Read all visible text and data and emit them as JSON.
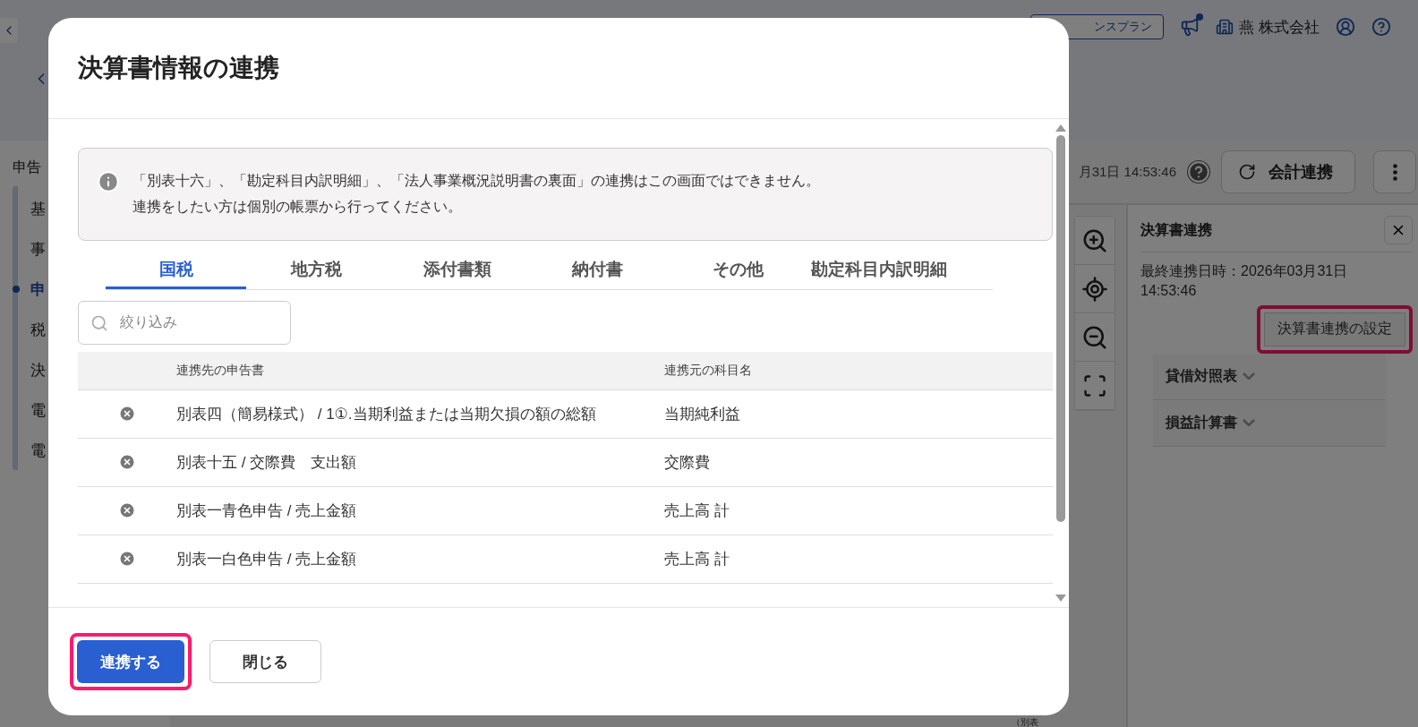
{
  "app_header": {
    "plan_button": "ンスプラン",
    "company": "燕 株式会社",
    "has_notification": true
  },
  "sidebar": {
    "title": "申告",
    "items": [
      {
        "label": "基",
        "selected": false
      },
      {
        "label": "事",
        "selected": false
      },
      {
        "label": "申",
        "selected": true
      },
      {
        "label": "税",
        "selected": false
      },
      {
        "label": "決",
        "selected": false
      },
      {
        "label": "電",
        "selected": false
      },
      {
        "label": "電",
        "selected": false
      }
    ]
  },
  "toolbar": {
    "timestamp": "月31日 14:53:46",
    "sync_button": "会計連携"
  },
  "side_panel": {
    "title": "決算書連携",
    "last_sync": "最終連携日時：2026年03月31日 14:53:46",
    "settings_button": {
      "label": "決算書連携の設定",
      "highlighted": true
    },
    "sections": [
      {
        "label": "貸借対照表",
        "expanded": false
      },
      {
        "label": "損益計算書",
        "expanded": false
      }
    ]
  },
  "document_preview": {
    "text": "（別表"
  },
  "modal": {
    "title": "決算書情報の連携",
    "notice": [
      "「別表十六」、「勘定科目内訳明細」、「法人事業概況説明書の裏面」の連携はこの画面ではできません。",
      "連携をしたい方は個別の帳票から行ってください。"
    ],
    "tabs": [
      {
        "label": "国税",
        "selected": true
      },
      {
        "label": "地方税",
        "selected": false
      },
      {
        "label": "添付書類",
        "selected": false
      },
      {
        "label": "納付書",
        "selected": false
      },
      {
        "label": "その他",
        "selected": false
      },
      {
        "label": "勘定科目内訳明細",
        "selected": false
      }
    ],
    "filter": {
      "placeholder": "絞り込み"
    },
    "table": {
      "columns": [
        "連携先の申告書",
        "連携元の科目名"
      ],
      "rows": [
        {
          "target": "別表四（簡易様式） / 1①.当期利益または当期欠損の額の総額",
          "source": "当期純利益"
        },
        {
          "target": "別表十五 / 交際費　支出額",
          "source": "交際費"
        },
        {
          "target": "別表一青色申告 / 売上金額",
          "source": "売上高 計"
        },
        {
          "target": "別表一白色申告 / 売上金額",
          "source": "売上高 計"
        }
      ]
    },
    "buttons": [
      {
        "label": "連携する",
        "kind": "primary",
        "highlighted": true
      },
      {
        "label": "閉じる",
        "kind": "secondary",
        "highlighted": false
      }
    ]
  }
}
